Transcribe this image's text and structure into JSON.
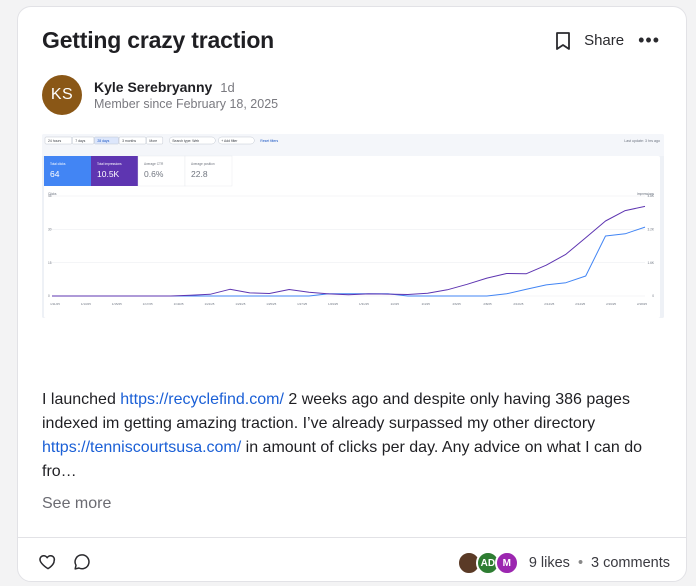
{
  "post": {
    "title": "Getting crazy traction",
    "share_label": "Share",
    "more_label": "•••"
  },
  "author": {
    "initials": "KS",
    "avatar_color": "#8a5716",
    "name": "Kyle Serebryanny",
    "time_ago": "1d",
    "member_since": "Member since February 18, 2025"
  },
  "screenshot": {
    "range_buttons": [
      "24 hours",
      "7 days",
      "28 days",
      "3 months",
      "More"
    ],
    "selected_range": "28 days",
    "filters": [
      "Search type: Web",
      "+ Add filter",
      "Reset filters"
    ],
    "last_update": "Last update: 3 hrs ago",
    "metrics": [
      {
        "label": "Total clicks",
        "value": "64",
        "color": "#4285f4"
      },
      {
        "label": "Total impressions",
        "value": "10.5K",
        "color": "#5e35b1"
      },
      {
        "label": "Average CTR",
        "value": "0.6%",
        "color": "#ffffff"
      },
      {
        "label": "Average position",
        "value": "22.8",
        "color": "#ffffff"
      }
    ],
    "left_axis_label": "Clicks",
    "right_axis_label": "Impressions",
    "left_ticks": [
      "45",
      "30",
      "15",
      "0"
    ],
    "right_ticks": [
      "4.8K",
      "3.2K",
      "1.6K",
      "0"
    ],
    "x_ticks": [
      "1/11/25",
      "1/13/25",
      "1/15/25",
      "1/17/25",
      "1/19/25",
      "1/21/25",
      "1/23/25",
      "1/25/25",
      "1/27/25",
      "1/29/25",
      "1/31/25",
      "2/2/25",
      "2/4/25",
      "2/6/25",
      "2/8/25",
      "2/10/25",
      "2/12/25",
      "2/14/25",
      "2/16/25",
      "2/18/25"
    ]
  },
  "chart_data": {
    "type": "line",
    "ylim": [
      0,
      45
    ],
    "y2lim": [
      0,
      4800
    ],
    "series": [
      {
        "name": "Clicks",
        "color": "#4285f4",
        "axis": "left",
        "values": [
          0,
          0,
          0,
          0,
          0,
          0,
          0,
          0,
          0,
          0,
          0,
          0,
          0,
          0,
          1,
          1,
          1,
          1,
          0,
          0,
          0,
          0,
          0,
          1,
          3,
          5,
          6,
          9,
          27,
          28,
          31
        ]
      },
      {
        "name": "Impressions",
        "color": "#5e35b1",
        "axis": "right",
        "values": [
          0,
          0,
          0,
          0,
          0,
          0,
          0,
          40,
          80,
          320,
          150,
          120,
          310,
          180,
          100,
          60,
          100,
          90,
          70,
          130,
          300,
          560,
          860,
          1080,
          1070,
          1480,
          2000,
          2800,
          3600,
          4100,
          4300
        ]
      }
    ]
  },
  "content": {
    "text_before_link1": "I launched ",
    "link1": "https://recyclefind.com/",
    "text_after_link1": " 2 weeks ago and despite only having 386 pages indexed im getting amazing traction. I’ve already surpassed my other directory ",
    "link2": "https://tenniscourtsusa.com/",
    "text_after_link2": " in amount of clicks per day. Any advice on what I can do fro…",
    "see_more": "See more"
  },
  "footer": {
    "likes": "9 likes",
    "separator": "•",
    "comments": "3 comments",
    "liker_avatars": [
      {
        "initials": "",
        "color": "#5a3a26"
      },
      {
        "initials": "AD",
        "color": "#2e7d32"
      },
      {
        "initials": "M",
        "color": "#9c27b0"
      }
    ]
  }
}
